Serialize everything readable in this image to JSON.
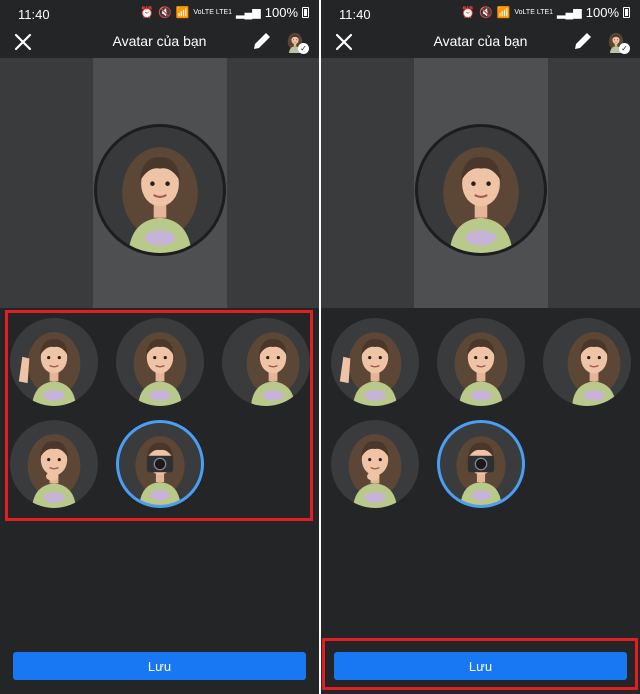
{
  "status_bar": {
    "time": "11:40",
    "network_label": "VoLTE LTE1",
    "battery_text": "100%"
  },
  "header": {
    "title": "Avatar của bạn"
  },
  "stickers": [
    {
      "pose": "waving"
    },
    {
      "pose": "shirt-pose"
    },
    {
      "pose": "side-turn"
    },
    {
      "pose": "hand-on-chin"
    },
    {
      "pose": "camera",
      "selected": true
    }
  ],
  "footer": {
    "save_label": "Lưu"
  },
  "colors": {
    "background": "#242526",
    "accent": "#1877f2",
    "selection_ring": "#4a9ff5",
    "highlight": "#e01e24"
  }
}
